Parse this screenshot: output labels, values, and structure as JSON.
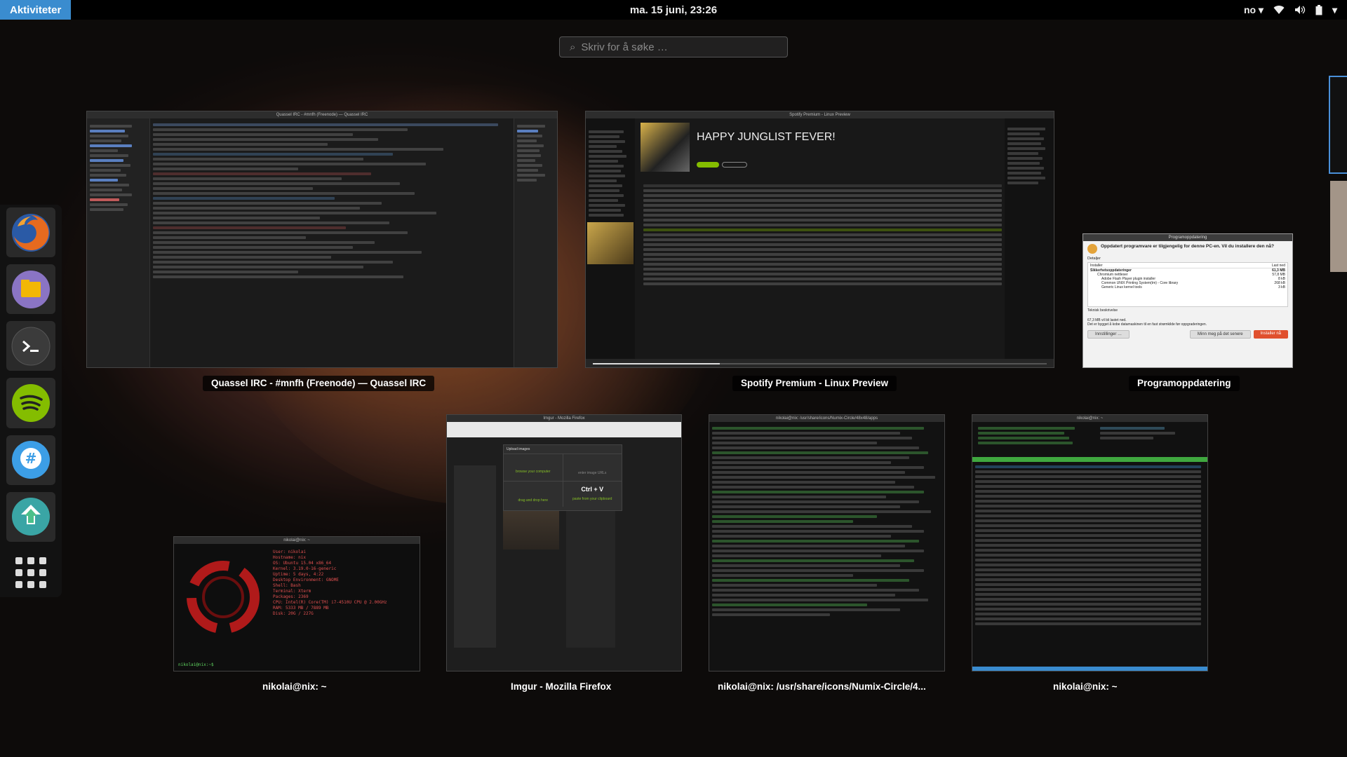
{
  "topbar": {
    "activities": "Aktiviteter",
    "clock": "ma. 15 juni, 23:26",
    "keyboard": "no",
    "icons": [
      "wifi-icon",
      "volume-icon",
      "battery-icon",
      "system-menu-icon"
    ]
  },
  "search": {
    "placeholder": "Skriv for å søke …"
  },
  "dash": {
    "apps": [
      {
        "name": "Firefox",
        "icon": "firefox-icon"
      },
      {
        "name": "Files",
        "icon": "files-icon"
      },
      {
        "name": "Terminal",
        "icon": "terminal-icon"
      },
      {
        "name": "Spotify",
        "icon": "spotify-icon"
      },
      {
        "name": "Quassel IRC",
        "icon": "quassel-icon"
      },
      {
        "name": "Software Update",
        "icon": "update-icon"
      }
    ],
    "show_apps_icon": "app-grid-icon"
  },
  "windows": [
    {
      "id": "quassel",
      "caption": "Quassel IRC - #mnfh (Freenode) — Quassel IRC",
      "title": "Quassel IRC - #mnfh (Freenode) — Quassel IRC"
    },
    {
      "id": "spotify",
      "caption": "Spotify Premium - Linux Preview",
      "title": "Spotify Premium - Linux Preview",
      "playlist": "HAPPY JUNGLIST FEVER!"
    },
    {
      "id": "update",
      "caption": "Programoppdatering",
      "title": "Programoppdatering",
      "heading": "Oppdatert programvare er tilgjengelig for denne PC-en. Vil du installere den nå?",
      "details": "Detaljer",
      "installed_col": "Installer",
      "size_col": "Last ned",
      "items": [
        "Sikkerhetsoppdateringer",
        "Chromium nettleser",
        "Adobe Flash Player plugin installer",
        "Common UNIX Printing System(tm) - Core library",
        "Generic Linux kernel tools"
      ],
      "sizes": [
        "61,3 MB",
        "57,8 MB",
        "8 kB",
        "268 kB",
        "3 kB"
      ],
      "desc": "Teknisk beskrivelse",
      "download_info": "67,3 MB vil bli lastet ned.",
      "backports": "Det er bygget å kobe datamaskinen til en fast strømkilde før oppgraderingen.",
      "settings_btn": "Innstillinger …",
      "remind_btn": "Minn meg på det senere",
      "install_btn": "Installer nå"
    },
    {
      "id": "nix1",
      "caption": "nikolai@nix: ~",
      "title": "nikolai@nix: ~",
      "info": [
        "User: nikolai",
        "Hostname: nix",
        "OS: Ubuntu 15.04 x86_64",
        "Kernel: 3.19.0-16-generic",
        "Uptime: 5 days, 4:22",
        "Desktop Environment: GNOME",
        "Shell: Bash",
        "Terminal: Xterm",
        "Packages: 2369",
        "CPU: Intel(R) Core(TM) i7-4510U CPU @ 2.00GHz",
        "RAM: 5333 MB / 7889 MB",
        "Disk: 20G / 227G"
      ],
      "prompt": "nikolai@nix:~$"
    },
    {
      "id": "imgur",
      "caption": "Imgur - Mozilla Firefox",
      "title": "Imgur - Mozilla Firefox",
      "dialog_title": "Upload images",
      "browse": "browse your computer",
      "drag": "drag and drop here",
      "paste": "Ctrl + V",
      "paste_sub": "paste from your clipboard",
      "url_placeholder": "enter image URLs"
    },
    {
      "id": "numix",
      "caption": "nikolai@nix: /usr/share/icons/Numix-Circle/4...",
      "title": "nikolai@nix: /usr/share/icons/Numix-Circle/48x48/apps"
    },
    {
      "id": "nix2",
      "caption": "nikolai@nix: ~",
      "title": "nikolai@nix: ~"
    }
  ]
}
